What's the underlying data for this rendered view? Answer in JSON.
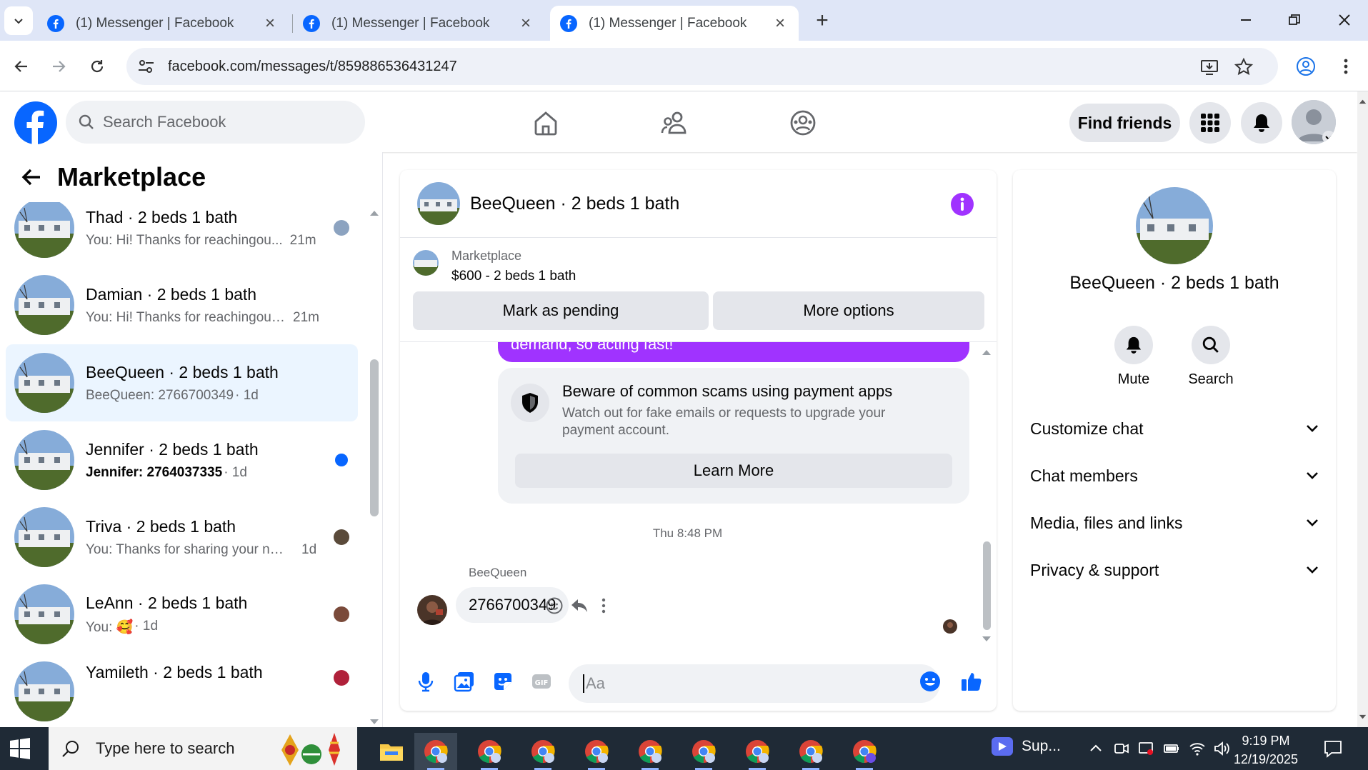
{
  "browser": {
    "tabs": [
      {
        "title": "(1) Messenger | Facebook",
        "active": false
      },
      {
        "title": "(1) Messenger | Facebook",
        "active": false
      },
      {
        "title": "(1) Messenger | Facebook",
        "active": true
      }
    ],
    "url": "facebook.com/messages/t/859886536431247"
  },
  "facebook": {
    "search_placeholder": "Search Facebook",
    "find_friends": "Find friends",
    "brand_color": "#0866ff"
  },
  "left": {
    "title": "Marketplace",
    "conversations": [
      {
        "name": "Thad · 2 beds 1 bath",
        "preview": "You: Hi! Thanks for reachingou...",
        "time": "21m",
        "selected": false,
        "unread": false
      },
      {
        "name": "Damian · 2 beds 1 bath",
        "preview": "You: Hi! Thanks for reachingout. Y...",
        "time": "21m",
        "selected": false,
        "unread": false
      },
      {
        "name": "BeeQueen · 2 beds 1 bath",
        "preview": "BeeQueen: 2766700349",
        "time": "· 1d",
        "selected": true,
        "unread": false
      },
      {
        "name": "Jennifer · 2 beds 1 bath",
        "preview": "Jennifer: 2764037335",
        "time": "· 1d",
        "selected": false,
        "unread": true
      },
      {
        "name": "Triva · 2 beds 1 bath",
        "preview": "You: Thanks for sharing your nu...",
        "time": "1d",
        "selected": false,
        "unread": false
      },
      {
        "name": "LeAnn · 2 beds 1 bath",
        "preview": "You: 🥰",
        "time": "· 1d",
        "selected": false,
        "unread": false
      },
      {
        "name": "Yamileth · 2 beds 1 bath",
        "preview": "",
        "time": "",
        "selected": false,
        "unread": false
      }
    ]
  },
  "chat": {
    "title": "BeeQueen · 2 beds 1 bath",
    "marketplace_label": "Marketplace",
    "listing": "$600 - 2 beds 1 bath",
    "mark_pending": "Mark as pending",
    "more_options": "More options",
    "prev_message_tail": "demand, so acting fast!",
    "scam_title": "Beware of common scams using payment apps",
    "scam_body": "Watch out for fake emails or requests to upgrade your payment account.",
    "learn_more": "Learn More",
    "timestamp": "Thu 8:48 PM",
    "sender": "BeeQueen",
    "message": "2766700349",
    "input_placeholder": "Aa",
    "accent": "#a033ff"
  },
  "right": {
    "name": "BeeQueen · 2 beds 1 bath",
    "mute": "Mute",
    "search": "Search",
    "sections": [
      "Customize chat",
      "Chat members",
      "Media, files and links",
      "Privacy & support"
    ]
  },
  "taskbar": {
    "search_placeholder": "Type here to search",
    "app_label": "Sup...",
    "time": "9:19 PM",
    "date": "12/19/2025"
  }
}
